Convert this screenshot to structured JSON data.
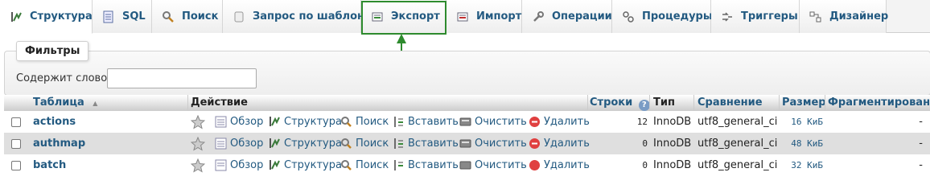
{
  "tabs": [
    {
      "label": "Структура",
      "icon": "structure-icon",
      "active": true
    },
    {
      "label": "SQL",
      "icon": "sql-icon"
    },
    {
      "label": "Поиск",
      "icon": "search-icon"
    },
    {
      "label": "Запрос по шаблону",
      "icon": "query-icon"
    },
    {
      "label": "Экспорт",
      "icon": "export-icon",
      "highlighted": true
    },
    {
      "label": "Импорт",
      "icon": "import-icon"
    },
    {
      "label": "Операции",
      "icon": "wrench-icon"
    },
    {
      "label": "Процедуры",
      "icon": "routines-icon"
    },
    {
      "label": "Триггеры",
      "icon": "triggers-icon"
    },
    {
      "label": "Дизайнер",
      "icon": "designer-icon"
    }
  ],
  "colors": {
    "highlight": "#2e8b2e",
    "link": "#235a81"
  },
  "filters": {
    "legend": "Фильтры",
    "label": "Содержит слово:",
    "value": ""
  },
  "table": {
    "headers": {
      "table": "Таблица",
      "sort_indicator": "▲",
      "action": "Действие",
      "rows": "Строки",
      "type": "Тип",
      "collation": "Сравнение",
      "size": "Размер",
      "overhead": "Фрагментировано"
    },
    "actions": {
      "browse": "Обзор",
      "structure": "Структура",
      "search": "Поиск",
      "insert": "Вставить",
      "empty": "Очистить",
      "drop": "Удалить"
    },
    "rows": [
      {
        "name": "actions",
        "rows": "12",
        "type": "InnoDB",
        "collation": "utf8_general_ci",
        "size": "16 КиБ",
        "overhead": "-"
      },
      {
        "name": "authmap",
        "rows": "0",
        "type": "InnoDB",
        "collation": "utf8_general_ci",
        "size": "48 КиБ",
        "overhead": "-"
      },
      {
        "name": "batch",
        "rows": "0",
        "type": "InnoDB",
        "collation": "utf8_general_ci",
        "size": "32 КиБ",
        "overhead": "-"
      }
    ]
  }
}
